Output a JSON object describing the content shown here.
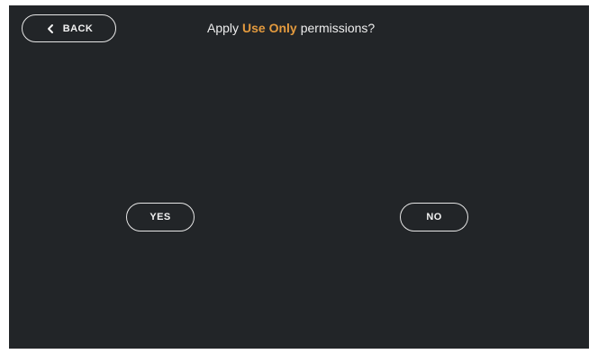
{
  "header": {
    "back_label": "BACK",
    "back_icon": "chevron-left-icon",
    "title_prefix": "Apply",
    "title_highlight": "Use Only",
    "title_suffix": "permissions?"
  },
  "actions": {
    "yes_label": "YES",
    "no_label": "NO"
  },
  "colors": {
    "background": "#222528",
    "accent": "#e39a3e",
    "text": "#eeeeee",
    "outline": "#e6e6e6"
  }
}
